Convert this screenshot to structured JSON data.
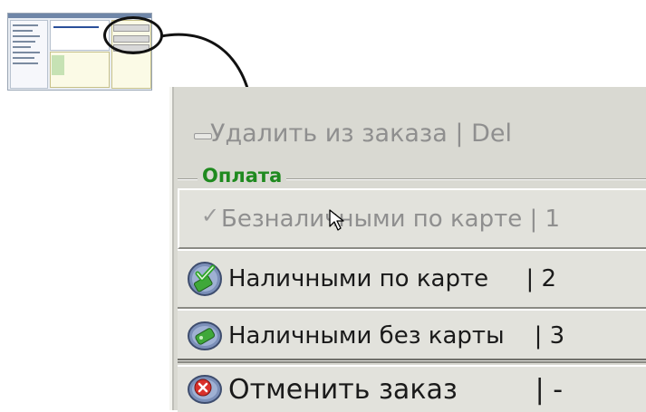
{
  "menu": {
    "remove_item": "Удалить из заказа | Del",
    "payment_group_title": "Оплата",
    "pay_card_cashless": "Безналичными по карте | 1",
    "pay_card_cash": "Наличными по карте     | 2",
    "pay_cash_no_card": "Наличными без карты    | 3",
    "cancel_order": "Отменить заказ         | -"
  },
  "icons": {
    "pay_card_cash": "green-check-card-icon",
    "pay_cash_no_card": "green-card-icon",
    "cancel_order": "red-x-icon"
  },
  "colors": {
    "group_title": "#1f8a1f",
    "disabled_text": "#8f8f8f",
    "panel_bg": "#d9d9d2"
  }
}
